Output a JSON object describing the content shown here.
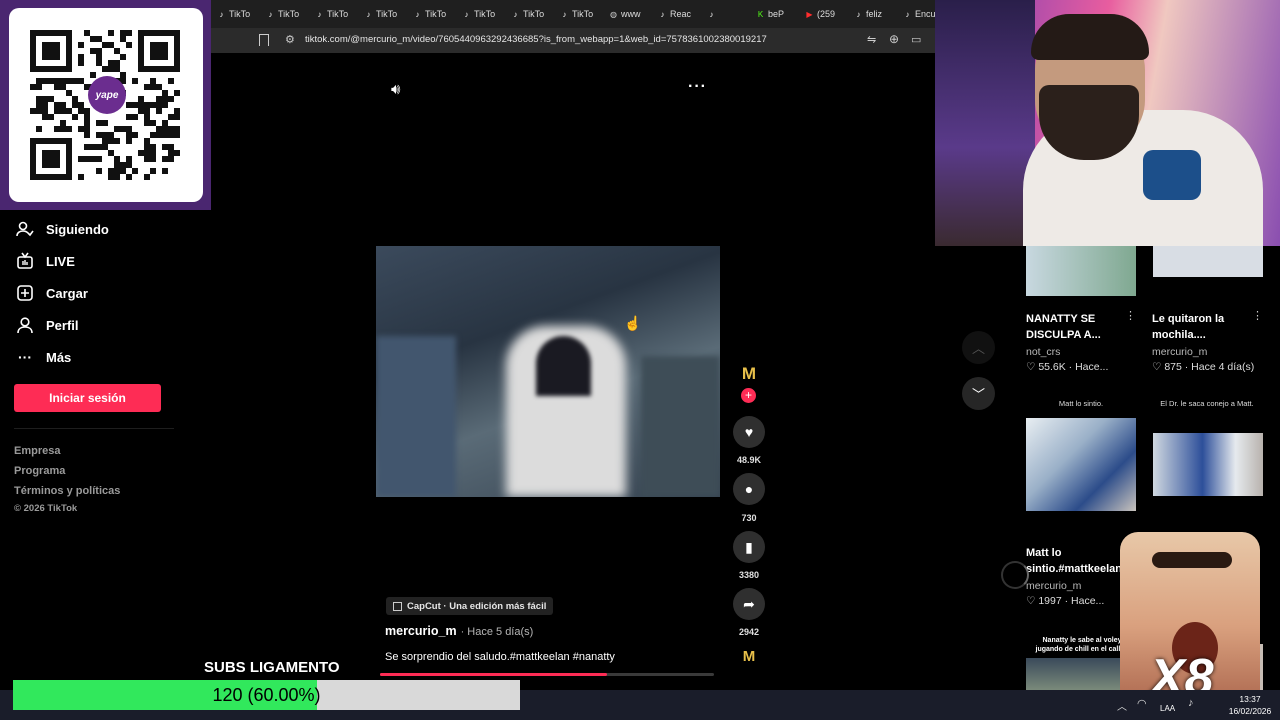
{
  "browser": {
    "tabs": [
      {
        "label": "TikTo",
        "icon": "tiktok-icon"
      },
      {
        "label": "TikTo",
        "icon": "tiktok-icon"
      },
      {
        "label": "TikTo",
        "icon": "tiktok-icon"
      },
      {
        "label": "TikTo",
        "icon": "tiktok-icon"
      },
      {
        "label": "TikTo",
        "icon": "tiktok-icon"
      },
      {
        "label": "TikTo",
        "icon": "tiktok-icon"
      },
      {
        "label": "TikTo",
        "icon": "tiktok-icon"
      },
      {
        "label": "TikTo",
        "icon": "tiktok-icon"
      },
      {
        "label": "www",
        "icon": "globe-icon"
      },
      {
        "label": "Reac",
        "icon": "tiktok-icon"
      },
      {
        "label": "",
        "icon": "tiktok-icon"
      },
      {
        "label": "beP",
        "icon": "kick-icon"
      },
      {
        "label": "(259",
        "icon": "youtube-icon"
      },
      {
        "label": "feliz",
        "icon": "tiktok-icon"
      },
      {
        "label": "Encu",
        "icon": "tiktok-icon"
      }
    ],
    "url": "tiktok.com/@mercurio_m/video/7605440963292436685?is_from_webapp=1&web_id=7578361002380019217"
  },
  "sidebar": {
    "items": [
      {
        "label": "Siguiendo",
        "icon": "following-icon"
      },
      {
        "label": "LIVE",
        "icon": "live-icon"
      },
      {
        "label": "Cargar",
        "icon": "upload-icon"
      },
      {
        "label": "Perfil",
        "icon": "profile-icon"
      },
      {
        "label": "Más",
        "icon": "more-icon"
      }
    ],
    "login_label": "Iniciar sesión",
    "footer": [
      "Empresa",
      "Programa",
      "Términos y políticas",
      "© 2026 TikTok"
    ]
  },
  "qr": {
    "logo_text": "yape"
  },
  "video": {
    "capcut_label": "CapCut · Una edición más fácil",
    "author": "mercurio_m",
    "time": "· Hace 5 día(s)",
    "caption": "Se sorprendio del  saludo.#mattkeelan #nanatty",
    "progress": 0.68,
    "likes": "48.9K",
    "comments": "730",
    "saves": "3380",
    "shares": "2942"
  },
  "recommendations": [
    {
      "title_line1": "NANATTY SE",
      "title_line2": "DISCULPA A...",
      "user": "not_crs",
      "meta": "♡ 55.6K · Hace..."
    },
    {
      "title_line1": "Le quitaron la",
      "title_line2": "mochila....",
      "user": "mercurio_m",
      "meta": "♡ 875 · Hace 4 día(s)"
    },
    {
      "thumb_caption": "Matt lo sintio."
    },
    {
      "thumb_caption": "El Dr. le saca conejo a Matt."
    },
    {
      "title_line1": "Matt lo",
      "title_line2": "sintio.#mattkeelan",
      "user": "mercurio_m",
      "meta": "♡ 1997 · Hace..."
    },
    {
      "thumb_caption": "Nanatty le sabe al voley jugando de chill en el callao"
    }
  ],
  "overlay": {
    "subs_title": "SUBS LIGAMENTO",
    "subs_label": "120 (60.00%)",
    "subs_progress": 0.6,
    "popup_text": "X8"
  },
  "taskbar": {
    "lang": "LAA",
    "time": "13:37",
    "date": "16/02/2026"
  },
  "colors": {
    "accent": "#fe2c55",
    "progress_green": "#31e85c",
    "qr_panel": "#4a2670"
  }
}
